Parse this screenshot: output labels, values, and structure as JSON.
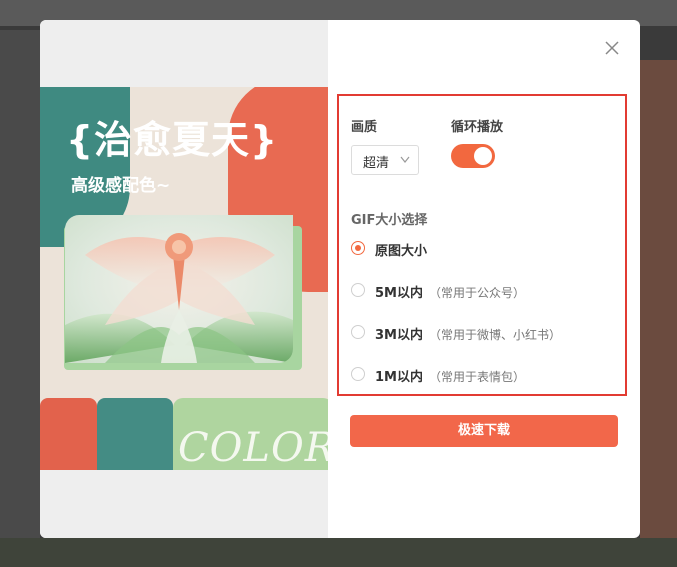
{
  "poster": {
    "title": "{治愈夏天}",
    "subtitle": "高级感配色~",
    "color_word": "COLOR"
  },
  "options": {
    "quality_label": "画质",
    "quality_value": "超清",
    "loop_label": "循环播放",
    "loop_enabled": true,
    "size_section_label": "GIF大小选择",
    "size_options": [
      {
        "label": "原图大小",
        "note": "",
        "selected": true
      },
      {
        "label": "5M以内",
        "note": "（常用于公众号）",
        "selected": false
      },
      {
        "label": "3M以内",
        "note": "（常用于微博、小红书）",
        "selected": false
      },
      {
        "label": "1M以内",
        "note": "（常用于表情包）",
        "selected": false
      }
    ]
  },
  "download_button": "极速下载",
  "colors": {
    "accent": "#f2683f",
    "highlight_border": "#e23b32",
    "teal": "#3f8a81",
    "coral": "#e86a52",
    "green": "#afd59f",
    "cream": "#ece3d9"
  },
  "icons": {
    "close": "close-icon",
    "dropdown": "chevron-down-icon"
  }
}
